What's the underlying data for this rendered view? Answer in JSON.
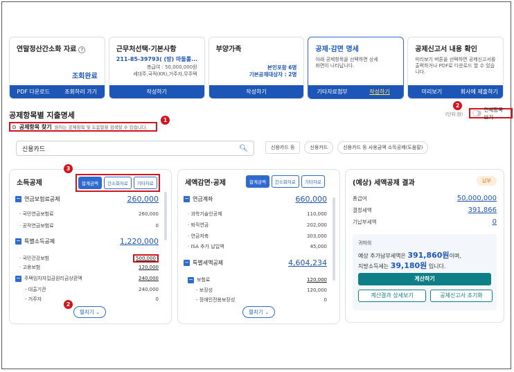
{
  "steps": [
    {
      "title": "연말정산간소화 자료",
      "help": "?",
      "status": "조회완료",
      "btn1": "PDF 다운로드",
      "btn2": "조회하러 가기"
    },
    {
      "title": "근무처선택·기본사항",
      "company": "211-85-39793( (방) 마돌롤...",
      "salary": "총급여 : 50,000,000원",
      "info": "세대주,국적(KR),거주자,무주택",
      "btn1": "작성하기"
    },
    {
      "title": "부양가족",
      "line1": "본인포함 6명",
      "line2": "기본공제대상자 : 2명",
      "btn1": "작성하기"
    },
    {
      "title": "공제·감면 명세",
      "desc": "아래 공제항목을 선택하면 상세화면이 나타납니다.",
      "btn1": "기타자료첨부",
      "btn2": "작성하기"
    },
    {
      "title": "공제신고서 내용 확인",
      "desc": "미리보기 버튼을 선택하면 공제신고서를 출력하거나 PDF로 다운로드 할 수 있습니다.",
      "btn1": "미리보기",
      "btn2": "회사에 제출하기"
    }
  ],
  "section": {
    "title": "공제항목별 지출명세",
    "unit": "(단위:원)",
    "toggle_label": "전체항목 보기"
  },
  "find": {
    "title": "공제항목 찾기",
    "desc": "원하는 공제항목 및 도움말을 검색할 수 있습니다."
  },
  "search": {
    "value": "신용카드"
  },
  "chips": [
    "신용카드 등",
    "신용카드",
    "신용카드 등 사용금액 소득공제(도움말)"
  ],
  "markers": [
    "1",
    "2",
    "3",
    "2"
  ],
  "income": {
    "title": "소득공제",
    "tabs": [
      "합계금액",
      "간소화자료",
      "기타자료"
    ],
    "pension_title": "연금보험료공제",
    "pension_total": "260,000",
    "pension_items": [
      {
        "label": "· 국민연금보험료",
        "value": "260,000"
      },
      {
        "label": "· 공적연금보험료",
        "value": "0"
      }
    ],
    "special_title": "특별소득공제",
    "special_total": "1,220,000",
    "special_items": [
      {
        "label": "· 국민건강보험",
        "value": "500,000"
      },
      {
        "label": "· 고용보험",
        "value": "120,000"
      },
      {
        "label": "주택임차차입금원리금상환액",
        "value": "240,000"
      },
      {
        "label": "- 대출기관",
        "value": "240,000"
      },
      {
        "label": "- 거주자",
        "value": "0"
      }
    ],
    "more": "펼치기"
  },
  "tax": {
    "title": "세액감면·공제",
    "tabs": [
      "합계금액",
      "간소화자료",
      "기타자료"
    ],
    "pension_title": "연금계좌",
    "pension_total": "660,000",
    "pension_items": [
      {
        "label": "· 과학기술인공제",
        "value": "110,000"
      },
      {
        "label": "· 퇴직연금",
        "value": "202,000"
      },
      {
        "label": "· 연금저축",
        "value": "303,000"
      },
      {
        "label": "· ISA 추가 납입액",
        "value": "45,000"
      }
    ],
    "special_title": "특별세액공제",
    "special_total": "4,604,234",
    "special_items": [
      {
        "label": "보험료",
        "value": "120,000"
      },
      {
        "label": "- 보장성",
        "value": "120,000"
      },
      {
        "label": "- 장애인전용보장성",
        "value": "0"
      }
    ],
    "more": "펼치기"
  },
  "result": {
    "title": "(예상) 세액공제 결과",
    "badge": "납부",
    "rows": [
      {
        "label": "총급여",
        "value": "50,000,000"
      },
      {
        "label": "결정세액",
        "value": "391,866"
      },
      {
        "label": "기납부세액",
        "value": "0"
      }
    ],
    "greet": "귀하의",
    "msg1a": "예상 추가납부세액은 ",
    "msg1b": "391,860원",
    "msg1c": "이며,",
    "msg2a": "지방소득세는 ",
    "msg2b": "39,180원",
    "msg2c": " 입니다.",
    "calc": "계산하기",
    "detail": "계산결과 상세보기",
    "reset": "공제신고서 초기화"
  }
}
